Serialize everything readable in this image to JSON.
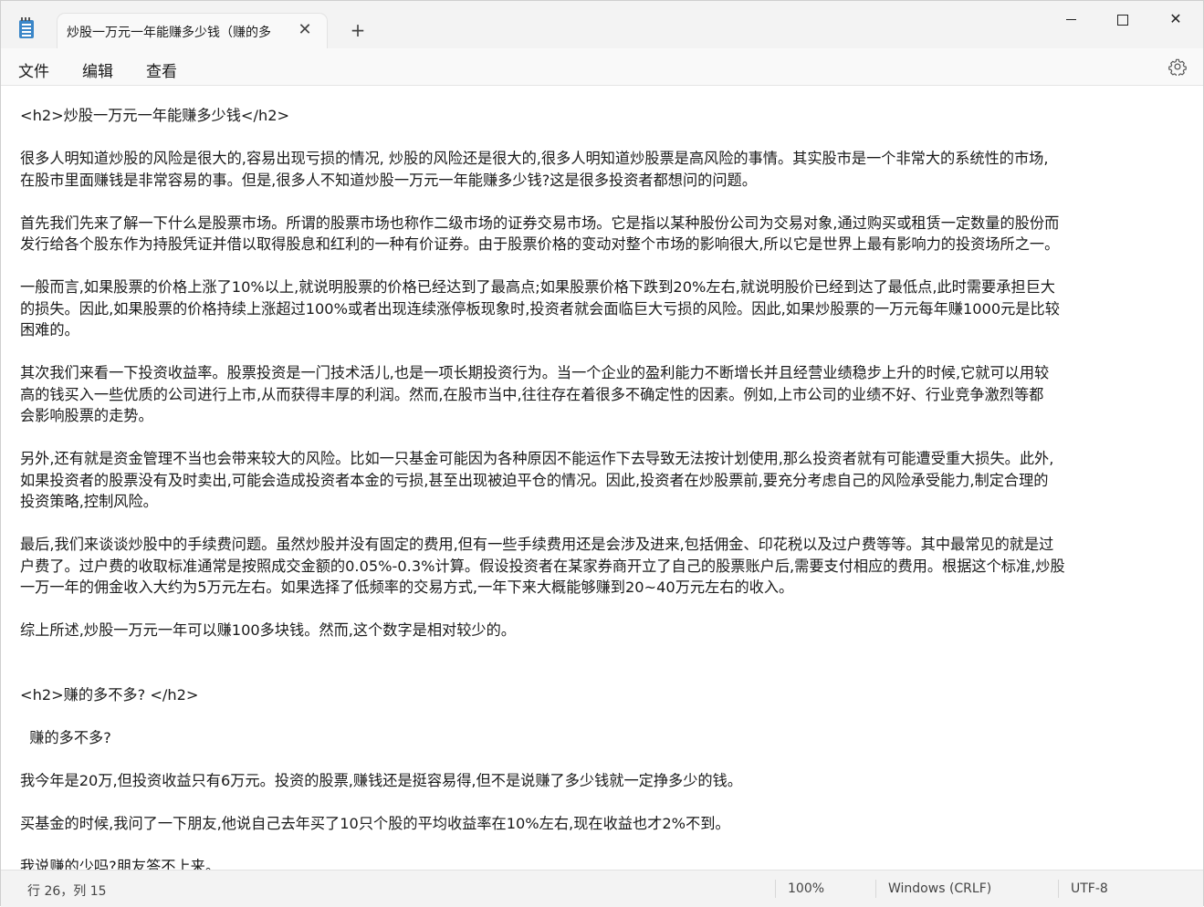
{
  "titlebar": {
    "tab_title": "炒股一万元一年能赚多少钱（赚的多",
    "close_glyph": "✕",
    "new_tab_glyph": "+",
    "window_close_glyph": "✕"
  },
  "menu": {
    "file": "文件",
    "edit": "编辑",
    "view": "查看"
  },
  "document": {
    "lines": [
      "<h2>炒股一万元一年能赚多少钱</h2>",
      "",
      "很多人明知道炒股的风险是很大的,容易出现亏损的情况, 炒股的风险还是很大的,很多人明知道炒股票是高风险的事情。其实股市是一个非常大的系统性的市场,",
      "在股市里面赚钱是非常容易的事。但是,很多人不知道炒股一万元一年能赚多少钱?这是很多投资者都想问的问题。",
      "",
      "首先我们先来了解一下什么是股票市场。所谓的股票市场也称作二级市场的证券交易市场。它是指以某种股份公司为交易对象,通过购买或租赁一定数量的股份而",
      "发行给各个股东作为持股凭证并借以取得股息和红利的一种有价证券。由于股票价格的变动对整个市场的影响很大,所以它是世界上最有影响力的投资场所之一。",
      "",
      "一般而言,如果股票的价格上涨了10%以上,就说明股票的价格已经达到了最高点;如果股票价格下跌到20%左右,就说明股价已经到达了最低点,此时需要承担巨大",
      "的损失。因此,如果股票的价格持续上涨超过100%或者出现连续涨停板现象时,投资者就会面临巨大亏损的风险。因此,如果炒股票的一万元每年赚1000元是比较",
      "困难的。",
      "",
      "其次我们来看一下投资收益率。股票投资是一门技术活儿,也是一项长期投资行为。当一个企业的盈利能力不断增长并且经营业绩稳步上升的时候,它就可以用较",
      "高的钱买入一些优质的公司进行上市,从而获得丰厚的利润。然而,在股市当中,往往存在着很多不确定性的因素。例如,上市公司的业绩不好、行业竞争激烈等都",
      "会影响股票的走势。",
      "",
      "另外,还有就是资金管理不当也会带来较大的风险。比如一只基金可能因为各种原因不能运作下去导致无法按计划使用,那么投资者就有可能遭受重大损失。此外,",
      "如果投资者的股票没有及时卖出,可能会造成投资者本金的亏损,甚至出现被迫平仓的情况。因此,投资者在炒股票前,要充分考虑自己的风险承受能力,制定合理的",
      "投资策略,控制风险。",
      "",
      "最后,我们来谈谈炒股中的手续费问题。虽然炒股并没有固定的费用,但有一些手续费用还是会涉及进来,包括佣金、印花税以及过户费等等。其中最常见的就是过",
      "户费了。过户费的收取标准通常是按照成交金额的0.05%-0.3%计算。假设投资者在某家券商开立了自己的股票账户后,需要支付相应的费用。根据这个标准,炒股",
      "一万一年的佣金收入大约为5万元左右。如果选择了低频率的交易方式,一年下来大概能够赚到20~40万元左右的收入。",
      "",
      "综上所述,炒股一万元一年可以赚100多块钱。然而,这个数字是相对较少的。",
      "",
      "",
      "<h2>赚的多不多? </h2>",
      "",
      "  赚的多不多?",
      "",
      "我今年是20万,但投资收益只有6万元。投资的股票,赚钱还是挺容易得,但不是说赚了多少钱就一定挣多少的钱。",
      "",
      "买基金的时候,我问了一下朋友,他说自己去年买了10只个股的平均收益率在10%左右,现在收益也才2%不到。",
      "",
      "我说赚的少吗?朋友答不上来。"
    ]
  },
  "statusbar": {
    "position": "行 26，列 15",
    "zoom": "100%",
    "line_ending": "Windows (CRLF)",
    "encoding": "UTF-8"
  }
}
